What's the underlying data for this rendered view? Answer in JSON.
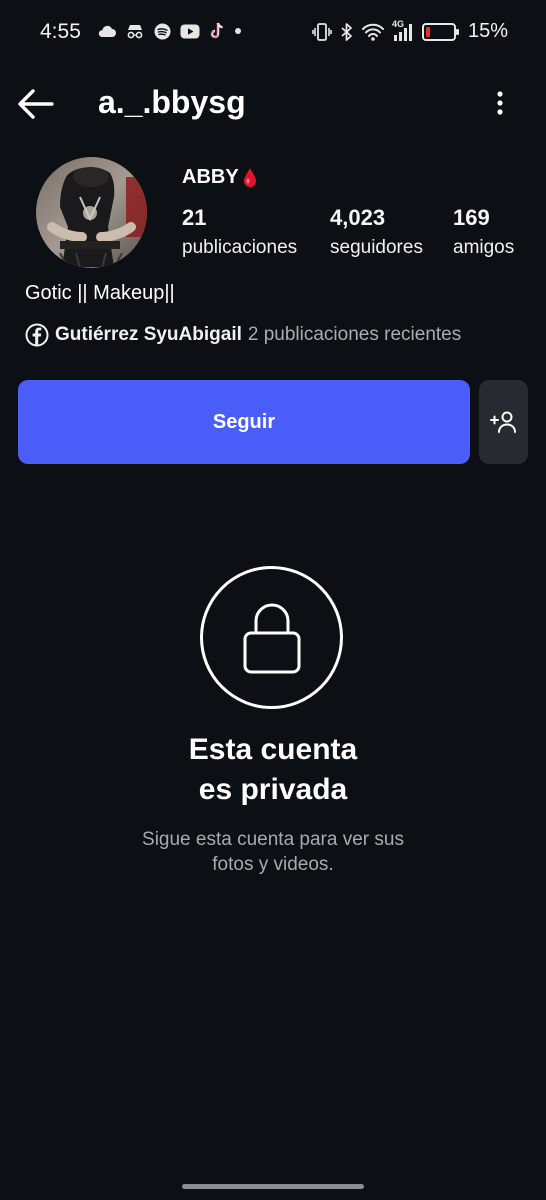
{
  "status_bar": {
    "time": "4:55",
    "battery_percent": "15%",
    "battery_level": 0.15,
    "network": "4G",
    "left_icons": [
      "cloud-icon",
      "incognito-icon",
      "spotify-icon",
      "youtube-icon",
      "tiktok-icon",
      "dot-icon"
    ],
    "right_icons": [
      "vibrate-icon",
      "bluetooth-icon",
      "wifi-icon",
      "signal-4g-icon",
      "battery-icon"
    ]
  },
  "header": {
    "username": "a._.bbysg",
    "back_icon": "arrow-left-icon",
    "menu_icon": "more-vertical-icon"
  },
  "profile": {
    "display_name": "ABBY",
    "name_emoji": "blood-drop-icon",
    "stats": [
      {
        "value": "21",
        "label": "publicaciones"
      },
      {
        "value": "4,023",
        "label": "seguidores"
      },
      {
        "value": "169",
        "label": "amigos"
      }
    ],
    "bio": "Gotic || Makeup||",
    "facebook_name": "Gutiérrez SyuAbigail",
    "facebook_recent": "2 publicaciones recientes"
  },
  "actions": {
    "follow_label": "Seguir",
    "add_friend_icon": "add-person-icon"
  },
  "private_notice": {
    "title_line1": "Esta cuenta",
    "title_line2": "es privada",
    "subtitle_line1": "Sigue esta cuenta para ver sus",
    "subtitle_line2": "fotos y videos."
  },
  "colors": {
    "background": "#0c1014",
    "primary_button": "#4a5df9",
    "secondary_button": "#272b31",
    "muted_text": "#a6abb3",
    "battery_low": "#e3322c"
  }
}
